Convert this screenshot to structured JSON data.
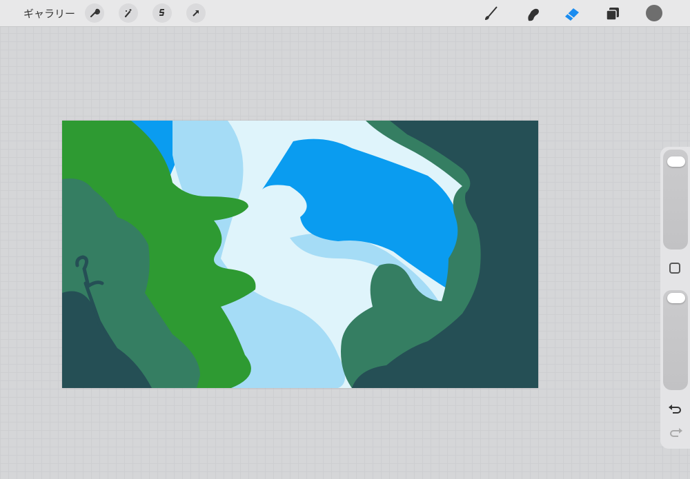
{
  "toolbar": {
    "gallery_label": "ギャラリー",
    "left_tools": [
      "wrench-icon",
      "magic-wand-icon",
      "selection-icon",
      "transform-arrow-icon"
    ],
    "right_tools": [
      "brush-icon",
      "smudge-icon",
      "eraser-icon",
      "layers-icon",
      "color-swatch"
    ],
    "active_tool": "eraser",
    "accent_color": "#1a8cf0",
    "current_color": "#6e6e6e"
  },
  "sidebar": {
    "brush_size": 0.95,
    "opacity": 1.0,
    "modify_button": "square-icon",
    "undo": "undo-icon",
    "redo": "redo-icon"
  },
  "artwork": {
    "colors": {
      "sky_light": "#dff4fb",
      "cloud": "#a5dcf6",
      "sky_blue": "#0a9cf0",
      "green": "#2e9a32",
      "teal": "#357e62",
      "dark_teal": "#254f55"
    }
  }
}
